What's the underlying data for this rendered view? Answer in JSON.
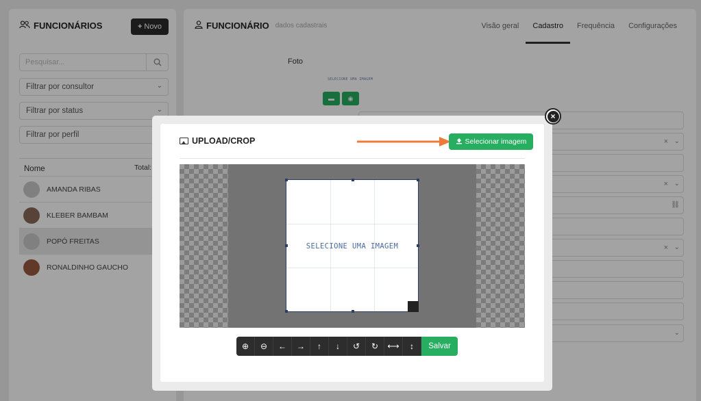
{
  "left": {
    "title": "FUNCIONÁRIOS",
    "new_button": "Novo",
    "search_placeholder": "Pesquisar...",
    "filters": [
      "Filtrar por consultor",
      "Filtrar por status",
      "Filtrar por perfil"
    ],
    "table_header": {
      "name": "Nome",
      "total": "Total:"
    },
    "employees": [
      "AMANDA RIBAS",
      "KLEBER BAMBAM",
      "POPÓ FREITAS",
      "RONALDINHO GAUCHO"
    ]
  },
  "right": {
    "title": "FUNCIONÁRIO",
    "subtitle": "dados cadastrais",
    "tabs": [
      "Visão geral",
      "Cadastro",
      "Frequência",
      "Configurações"
    ],
    "foto_label": "Foto",
    "foto_placeholder": "SELECIONE UMA IMAGEM"
  },
  "modal": {
    "title": "UPLOAD/CROP",
    "select_button": "Selecionar imagem",
    "crop_placeholder": "SELECIONE UMA IMAGEM",
    "save_button": "Salvar",
    "tools": [
      {
        "name": "zoom-in-icon",
        "glyph": "⊕"
      },
      {
        "name": "zoom-out-icon",
        "glyph": "⊖"
      },
      {
        "name": "arrow-left-icon",
        "glyph": "←"
      },
      {
        "name": "arrow-right-icon",
        "glyph": "→"
      },
      {
        "name": "arrow-up-icon",
        "glyph": "↑"
      },
      {
        "name": "arrow-down-icon",
        "glyph": "↓"
      },
      {
        "name": "rotate-left-icon",
        "glyph": "↺"
      },
      {
        "name": "rotate-right-icon",
        "glyph": "↻"
      },
      {
        "name": "flip-horizontal-icon",
        "glyph": "⟷"
      },
      {
        "name": "flip-vertical-icon",
        "glyph": "↕"
      }
    ]
  },
  "colors": {
    "accent": "#27ae60",
    "dark": "#2d2d2d",
    "arrow": "#f07a3a"
  }
}
